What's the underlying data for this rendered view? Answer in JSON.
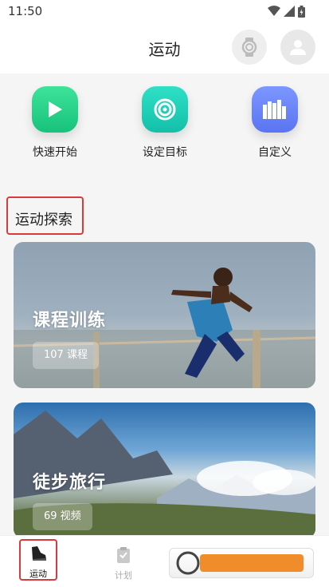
{
  "status_bar": {
    "time": "11:50"
  },
  "header": {
    "title": "运动"
  },
  "quick_actions": [
    {
      "label": "快速开始",
      "icon": "play-icon"
    },
    {
      "label": "设定目标",
      "icon": "target-icon"
    },
    {
      "label": "自定义",
      "icon": "bars-icon"
    }
  ],
  "section": {
    "title": "运动探索"
  },
  "cards": [
    {
      "title": "课程训练",
      "badge": "107 课程"
    },
    {
      "title": "徒步旅行",
      "badge": "69 视频"
    }
  ],
  "bottom_nav": [
    {
      "label": "运动",
      "icon": "shoe-icon",
      "active": true
    },
    {
      "label": "计划",
      "icon": "clipboard-icon",
      "active": false
    }
  ],
  "colors": {
    "accent_red": "#d83b3b",
    "green": "#17c27a",
    "teal": "#14bfa8",
    "blue": "#5b74f2"
  }
}
